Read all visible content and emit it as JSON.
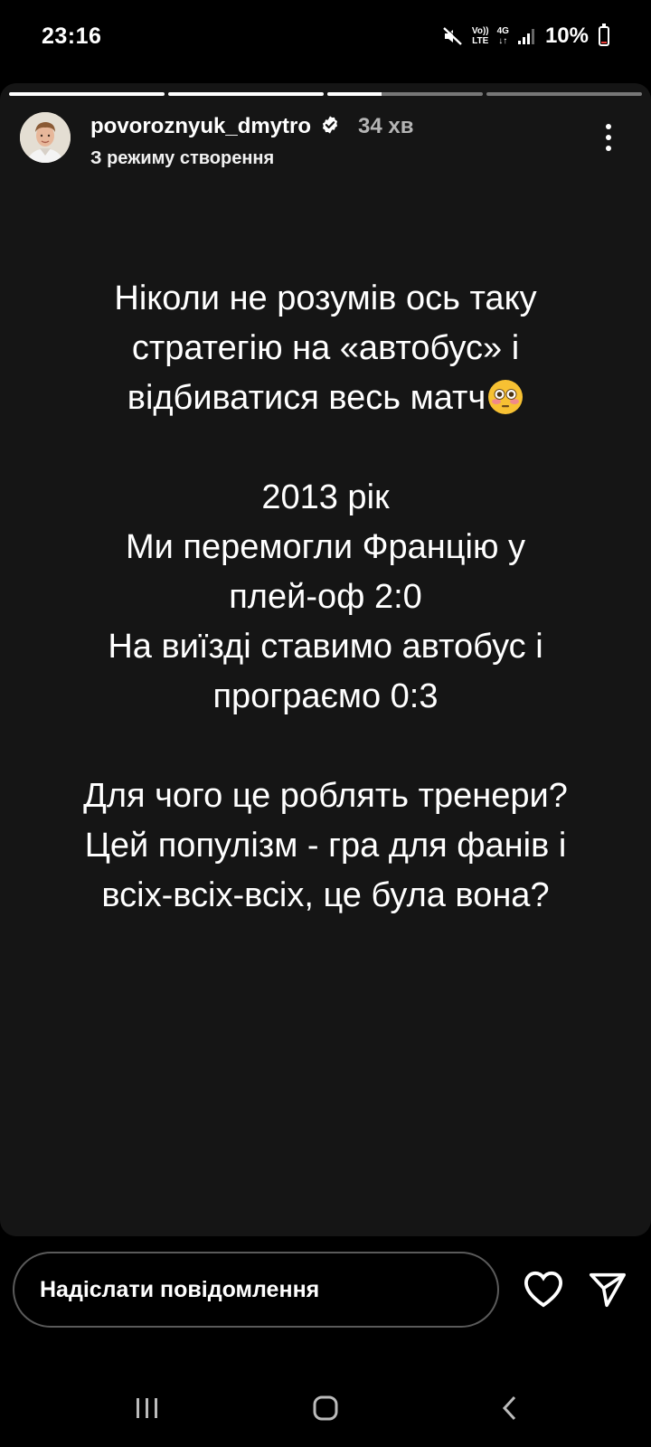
{
  "status_bar": {
    "time": "23:16",
    "net_top": "Vo))",
    "net_bottom": "LTE",
    "gen": "4G",
    "battery": "10%",
    "battery_level": 0.1
  },
  "story": {
    "progress_segments": [
      1,
      1,
      0.35,
      0
    ],
    "username": "povoroznyuk_dmytro",
    "time_ago": "34 хв",
    "subtitle": "З режиму створення",
    "lines": [
      "Ніколи не розумів ось таку",
      "стратегію на «автобус» і",
      "відбиватися весь матч",
      "",
      "2013 рік",
      "Ми перемогли Францію у",
      "плей-оф 2:0",
      "На виїзді ставимо автобус і",
      "програємо 0:3",
      "",
      "Для чого це роблять тренери?",
      "Цей популізм - гра для фанів і",
      "всіх-всіх-всіх, це була вона?"
    ],
    "emoji": "flushed-face"
  },
  "reply": {
    "placeholder": "Надіслати повідомлення"
  },
  "icons": {
    "verified": "verified-badge-icon",
    "more": "more-vert-icon",
    "heart": "heart-icon",
    "send": "send-icon"
  }
}
